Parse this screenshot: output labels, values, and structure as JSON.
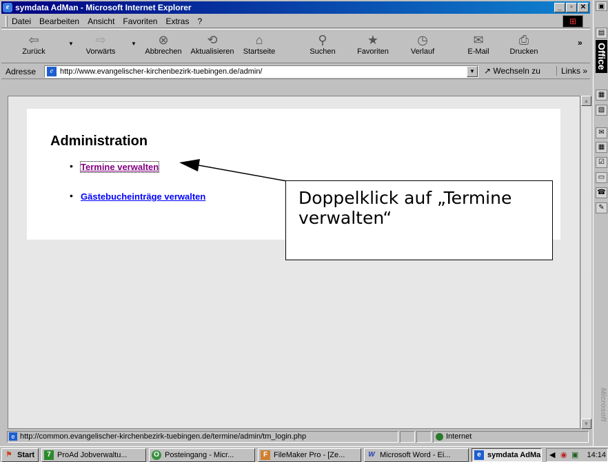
{
  "window": {
    "title": "symdata AdMan - Microsoft Internet Explorer"
  },
  "menu": [
    "Datei",
    "Bearbeiten",
    "Ansicht",
    "Favoriten",
    "Extras",
    "?"
  ],
  "toolbar": [
    {
      "label": "Zurück",
      "icon": "back-arrow-icon"
    },
    {
      "label": "Vorwärts",
      "icon": "forward-arrow-icon"
    },
    {
      "label": "Abbrechen",
      "icon": "stop-icon"
    },
    {
      "label": "Aktualisieren",
      "icon": "refresh-icon"
    },
    {
      "label": "Startseite",
      "icon": "home-icon"
    },
    {
      "label": "Suchen",
      "icon": "search-icon"
    },
    {
      "label": "Favoriten",
      "icon": "favorites-icon"
    },
    {
      "label": "Verlauf",
      "icon": "history-icon"
    },
    {
      "label": "E-Mail",
      "icon": "mail-icon"
    },
    {
      "label": "Drucken",
      "icon": "print-icon"
    }
  ],
  "address": {
    "label": "Adresse",
    "url": "http://www.evangelischer-kirchenbezirk-tuebingen.de/admin/",
    "go_label": "Wechseln zu",
    "links_label": "Links"
  },
  "page": {
    "heading": "Administration",
    "links": [
      {
        "label": "Termine verwalten",
        "color": "#800080"
      },
      {
        "label": "Gästebucheinträge verwalten",
        "color": "#0000ff"
      }
    ]
  },
  "callout": {
    "text": "Doppelklick auf „Termine verwalten“"
  },
  "status": {
    "url": "http://common.evangelischer-kirchenbezirk-tuebingen.de/termine/admin/tm_login.php",
    "zone": "Internet"
  },
  "office_bar": {
    "label": "Office",
    "brand": "Microsoft"
  },
  "taskbar": {
    "start": "Start",
    "tasks": [
      "ProAd Jobverwaltu...",
      "Posteingang - Micr...",
      "FileMaker Pro - [Ze...",
      "Microsoft Word - Ei...",
      "symdata AdMa..."
    ],
    "clock": "14:14"
  }
}
